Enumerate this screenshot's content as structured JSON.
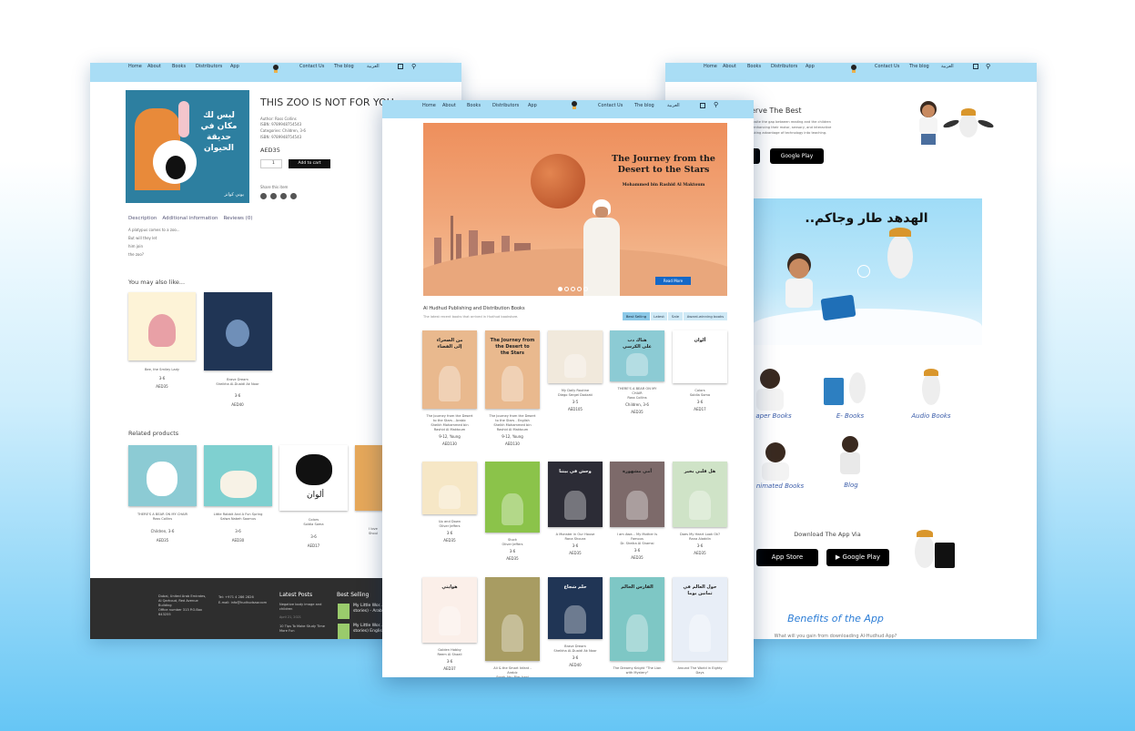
{
  "left": {
    "nav": [
      "Home",
      "About",
      "Books",
      "Distributors",
      "App",
      "Contact Us",
      "The blog",
      "العربية"
    ],
    "product_title": "THIS ZOO IS NOT FOR YOU",
    "cover_title": "ليس لك مكان في حديقة الحيوان",
    "cover_author": "يوني كوانز",
    "meta": [
      "Author: Ross Collins",
      "ISBN: 9789948754543",
      "Categories: Children, 3-6",
      "ISBN: 9789948754543"
    ],
    "price": "AED35",
    "qty": "1",
    "add_to_cart": "Add to cart",
    "share_label": "Share this item",
    "tabs": [
      "Description",
      "Additional information",
      "Reviews (0)"
    ],
    "desc_lines": [
      "A platypus comes to a zoo...",
      "But will they let",
      "him join",
      "the zoo?"
    ],
    "you_may_title": "You may also like...",
    "you_may": [
      {
        "title": "Bee, the Smiley Lady",
        "age": "3-6",
        "price": "AED35"
      },
      {
        "title": "Brave Dream\nSheikha Al-Duaidi Ak Noor",
        "age": "3-6",
        "price": "AED40"
      }
    ],
    "related_title": "Related products",
    "related": [
      {
        "title": "THERE'S A BEAR ON MY CHAIR\nRoss Collins",
        "age": "Children, 3-6",
        "price": "AED35"
      },
      {
        "title": "Little Rabbit And A Fun Spring\nSalwa Nabeh Soomus",
        "age": "3-6",
        "price": "AED30"
      },
      {
        "title": "Colors\nSoldia Soma",
        "age": "3-6",
        "price": "AED17"
      },
      {
        "title": "I love\nShoul",
        "age": "",
        "price": ""
      }
    ],
    "footer": {
      "address": "Dubai, United Arab Emirates,\nAl Qarhoud, Red Avenue\nBuilding\nOffice number 313 P.O.Box\n643255",
      "contact": "Tel: +971 4 286 2826\nE-mail: info@hudhudsaw.com",
      "latest_posts_title": "Latest Posts",
      "posts": [
        "Negative body image and children",
        "April 21, 2021",
        "10 Tips To Make Study Time More Fun"
      ],
      "best_selling_title": "Best Selling",
      "best": [
        "My Little Wor... stories) - Arab...",
        "My Little Wor... stories) English"
      ]
    }
  },
  "center": {
    "nav": [
      "Home",
      "About",
      "Books",
      "Distributors",
      "App",
      "Contact Us",
      "The blog",
      "العربية"
    ],
    "hero_title": "The Journey from the\nDesert to the Stars",
    "hero_subtitle": "Mohammed bin Rashid Al Maktoum",
    "hero_button": "Read More",
    "section_title": "Al Hudhud Publishing and Distribution Books",
    "section_subtitle": "The latest recent books that arrived in Hudhud bookstore.",
    "filters": [
      {
        "label": "Best Selling",
        "active": true
      },
      {
        "label": "Latest",
        "active": false
      },
      {
        "label": "Sale",
        "active": false
      },
      {
        "label": "Award-winning books",
        "active": false
      }
    ],
    "rows": [
      [
        {
          "title": "The Journey from the Desert\nto the Stars - Arabic\nSheikh Mohammed bin\nRashid Al Maktoum",
          "age": "9-12, Young",
          "price": "AED130",
          "cover": "من الصحراء\nإلى الفضاء",
          "bg": "#e9b98e"
        },
        {
          "title": "The Journey from the Desert\nto the Stars - English\nSheikh Mohammed bin\nRashid Al Maktoum",
          "age": "9-12, Young",
          "price": "AED130",
          "cover": "The Journey from\nthe Desert to\nthe Stars",
          "bg": "#e9b98e"
        },
        {
          "title": "My Daily Routine\nDiego Sergei Dodzati",
          "age": "3-5",
          "price": "AED105",
          "cover": "",
          "bg": "#f1e9dc"
        },
        {
          "title": "THERE'S A BEAR ON MY\nCHAIR\nRoss Collins",
          "age": "Children, 3-6",
          "price": "AED35",
          "cover": "هناك دب\nعلى الكرسي",
          "bg": "#8ccbd4"
        },
        {
          "title": "Colors\nSoldia Soma",
          "age": "3-6",
          "price": "AED17",
          "cover": "ألوان",
          "bg": "#ffffff"
        }
      ],
      [
        {
          "title": "Up and Down\nOliver Jeffers",
          "age": "3-6",
          "price": "AED35",
          "cover": "",
          "bg": "#f6e7c6"
        },
        {
          "title": "Stuck\nOliver Jeffers",
          "age": "3-6",
          "price": "AED35",
          "cover": "",
          "bg": "#8bc34a"
        },
        {
          "title": "A Monster in Our House\nRana Shoura",
          "age": "3-6",
          "price": "AED35",
          "cover": "وحش في بيتنا",
          "bg": "#2c2c36"
        },
        {
          "title": "I am Awe... My Mother Is\nFamous\nDr. Sheika Al Shamsi",
          "age": "3-6",
          "price": "AED35",
          "cover": "أمي مشهورة",
          "bg": "#7d6a6a"
        },
        {
          "title": "Does My Heart Look Ok?\nRana Aladdin",
          "age": "3-6",
          "price": "AED35",
          "cover": "هل قلبي بخير",
          "bg": "#cfe3c7"
        }
      ],
      [
        {
          "title": "Golden Hobby\nReem Al Shaali",
          "age": "3-6",
          "price": "AED37",
          "cover": "هوايتي",
          "bg": "#fbefe9"
        },
        {
          "title": "Ali & the Smart Infant -\nArabic\nSmah Abu Bier Irani",
          "age": "3-6",
          "price": "",
          "cover": "",
          "bg": "#a89c62"
        },
        {
          "title": "Brave Dream\nSheikha Al-Duaidi Ak Noor",
          "age": "3-6",
          "price": "AED40",
          "cover": "حلم شجاع",
          "bg": "#203555"
        },
        {
          "title": "The Dreamy Knight \"The Lion\nwith Mystery\"",
          "age": "",
          "price": "",
          "cover": "الفارس الحالم",
          "bg": "#7ec7c5"
        },
        {
          "title": "Around The World in Eighty\nDays",
          "age": "",
          "price": "",
          "cover": "حول العالم في ثمانين يوما",
          "bg": "#e8eef7"
        }
      ]
    ]
  },
  "right": {
    "nav": [
      "Home",
      "About",
      "Books",
      "Distributors",
      "App",
      "Contact Us",
      "The blog",
      "العربية"
    ],
    "heading": "erve The Best",
    "desc": "ebsite the gap between reading and the children\n, enhancing their motor, sensory, and interactive\ntaking advantage of technology into teaching.",
    "store_google": "Google Play",
    "video_title": "الهدهد طار وجاكم..",
    "categories": [
      "aper Books",
      "E- Books",
      "Audio Books",
      "nimated Books",
      "Blog"
    ],
    "download_title": "Download The App Via",
    "store_apple": "App Store",
    "benefits_title": "Benefits of the App",
    "benefits_sub": "What will you gain from downloading Al-Hudhud App?"
  }
}
